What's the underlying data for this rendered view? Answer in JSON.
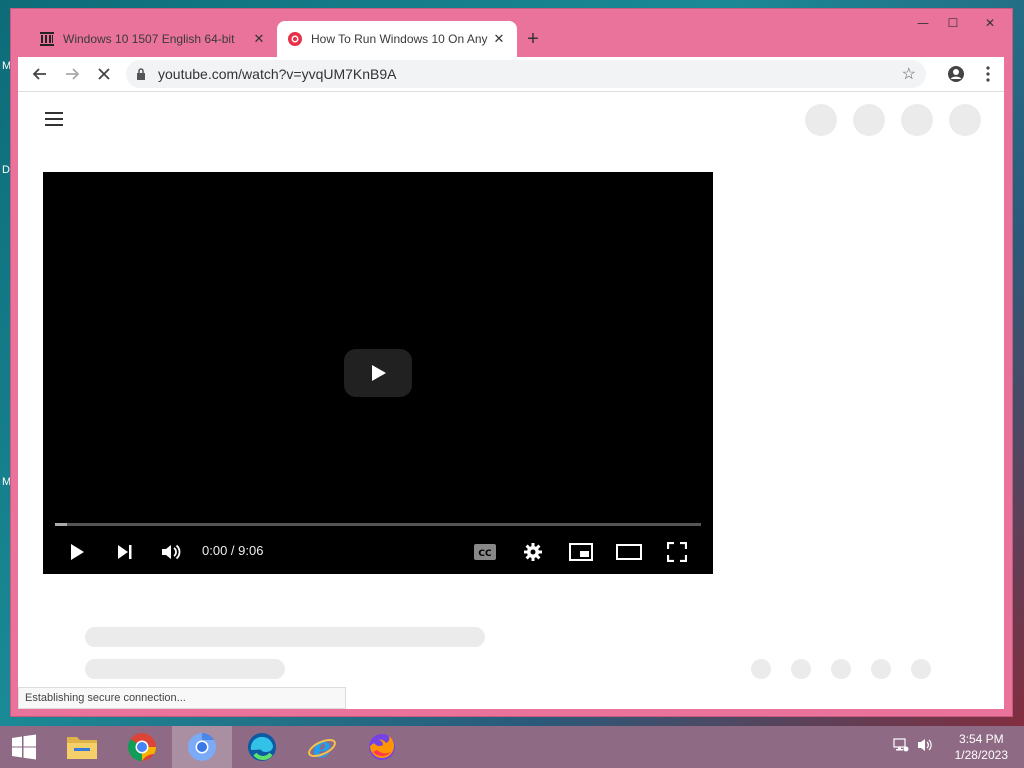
{
  "desktop": {
    "labels": [
      "M",
      "D",
      "M"
    ]
  },
  "window_controls": {
    "minimize": "—",
    "maximize": "☐",
    "close": "✕"
  },
  "tabs": [
    {
      "title": "Windows 10 1507 English 64-bit",
      "favicon": "archive-icon",
      "active": false
    },
    {
      "title": "How To Run Windows 10 On Any",
      "favicon": "youtube-icon",
      "active": true
    }
  ],
  "toolbar": {
    "url": "youtube.com/watch?v=yvqUM7KnB9A"
  },
  "player": {
    "time": "0:00 / 9:06",
    "progress": 0.0
  },
  "status": {
    "text": "Establishing secure connection..."
  },
  "taskbar": {
    "apps": [
      "start-icon",
      "file-explorer-icon",
      "chrome-icon",
      "chromium-icon",
      "edge-icon",
      "internet-explorer-icon",
      "firefox-icon"
    ],
    "clock_time": "3:54 PM",
    "clock_date": "1/28/2023"
  },
  "colors": {
    "window_frame": "#e9739a",
    "taskbar": "#8e6a85"
  }
}
